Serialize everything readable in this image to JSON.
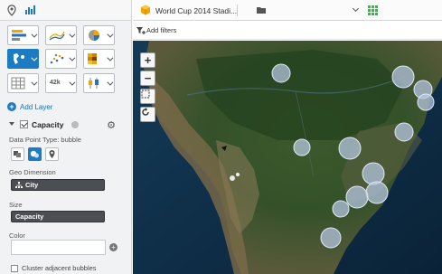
{
  "left_panel": {
    "tabs": [
      {
        "icon": "pin-icon",
        "active": true
      },
      {
        "icon": "bar-chart-icon",
        "active": false
      }
    ],
    "viz_buttons": [
      {
        "icon": "bar-chart-icon"
      },
      {
        "icon": "line-chart-icon"
      },
      {
        "icon": "pie-chart-icon"
      },
      {
        "icon": "map-icon",
        "active": true
      },
      {
        "icon": "scatter-icon"
      },
      {
        "icon": "heatmap-icon"
      },
      {
        "icon": "table-icon"
      },
      {
        "icon": "kpi-icon",
        "text": "42k"
      },
      {
        "icon": "boxplot-icon"
      }
    ],
    "add_layer_label": "Add Layer",
    "layer": {
      "title": "Capacity",
      "data_point_type_label": "Data Point Type: bubble",
      "geo_dimension_label": "Geo Dimension",
      "geo_dimension_value": "City",
      "size_label": "Size",
      "size_value": "Capacity",
      "color_label": "Color",
      "cluster_label": "Cluster adjacent bubbles"
    }
  },
  "topbar": {
    "title": "World Cup 2014 Stadi..."
  },
  "filterbar": {
    "label": "Add filters"
  },
  "map": {
    "controls": [
      "zoom-in",
      "zoom-out",
      "select",
      "reset"
    ],
    "bubble_color": "#b9c9e4"
  },
  "colors": {
    "accent": "#1d7bc4",
    "field_bg": "#4b4f54"
  }
}
